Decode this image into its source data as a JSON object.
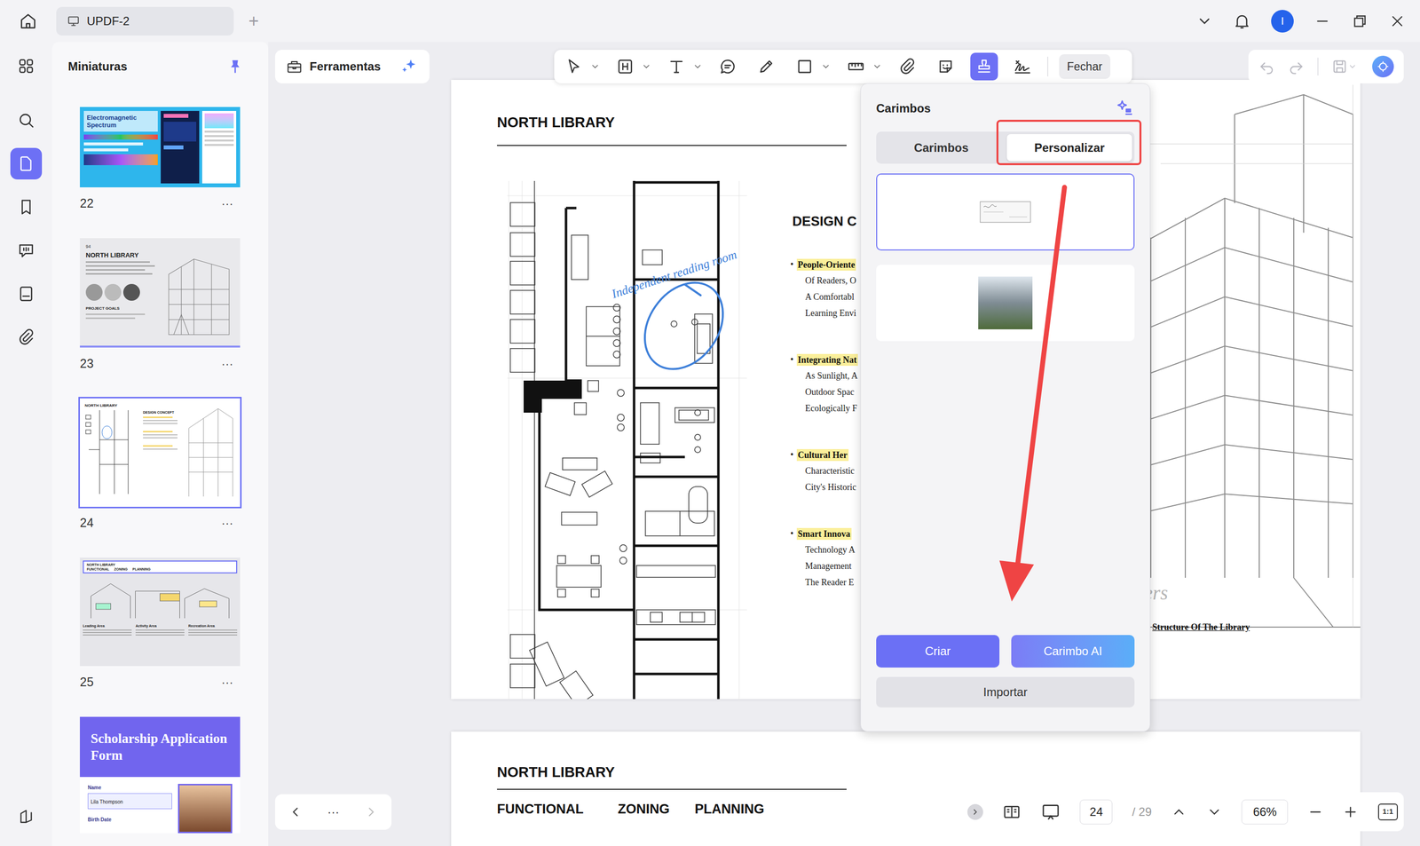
{
  "window": {
    "tab_title": "UPDF-2",
    "new_tab": "+",
    "avatar": "I"
  },
  "rail": [
    {
      "kind": "organize",
      "selected": false
    },
    {
      "kind": "search",
      "selected": false
    },
    {
      "kind": "pages",
      "selected": true
    },
    {
      "kind": "bookmark",
      "selected": false
    },
    {
      "kind": "comments",
      "selected": false
    },
    {
      "kind": "forms",
      "selected": false
    },
    {
      "kind": "attachments",
      "selected": false
    }
  ],
  "rail_bottom": {
    "kind": "theme",
    "selected": false
  },
  "thumbnails": {
    "title": "Miniaturas",
    "pages": [
      {
        "number": "22",
        "selected": false,
        "more": "···",
        "texts": [
          "Electromagnetic",
          "Spectrum"
        ]
      },
      {
        "number": "23",
        "selected": false,
        "more": "···",
        "texts": [
          "94",
          "NORTH LIBRARY",
          "PROJECT GOALS"
        ]
      },
      {
        "number": "24",
        "selected": true,
        "more": "···",
        "texts": [
          "NORTH LIBRARY",
          "DESIGN CONCEPT"
        ]
      },
      {
        "number": "25",
        "selected": false,
        "more": "···",
        "texts": [
          "NORTH LIBRARY",
          "FUNCTIONAL",
          "ZONING",
          "PLANNING",
          "Leading Area",
          "Activity Area",
          "Recreation Area"
        ]
      }
    ],
    "partial_page": {
      "title": "Scholarship Application Form",
      "field_label": "Name",
      "field_value": "Lila Thompson",
      "next_label": "Birth Date"
    }
  },
  "tools_panel": {
    "title": "Ferramentas",
    "nav_more": "···"
  },
  "toolbar": {
    "tools": [
      {
        "kind": "select",
        "menu": true,
        "selected": false
      },
      {
        "kind": "textbox",
        "menu": true,
        "selected": false
      },
      {
        "kind": "text",
        "menu": true,
        "selected": false
      },
      {
        "kind": "note",
        "menu": false,
        "selected": false
      },
      {
        "kind": "pencil",
        "menu": false,
        "selected": false
      },
      {
        "kind": "shape",
        "menu": true,
        "selected": false
      },
      {
        "kind": "measure",
        "menu": true,
        "selected": false
      },
      {
        "kind": "attach",
        "menu": false,
        "selected": false
      },
      {
        "kind": "sticker",
        "menu": false,
        "selected": false
      },
      {
        "kind": "stamp",
        "menu": false,
        "selected": true
      },
      {
        "kind": "signature",
        "menu": false,
        "selected": false
      }
    ],
    "close": "Fechar"
  },
  "actions": [
    {
      "kind": "undo",
      "disabled": true
    },
    {
      "kind": "redo",
      "disabled": true
    },
    {
      "kind": "save",
      "disabled": true
    }
  ],
  "stamp_panel": {
    "title": "Carimbos",
    "tabs": [
      {
        "label": "Carimbos",
        "selected": false,
        "highlighted": false
      },
      {
        "label": "Personalizar",
        "selected": true,
        "highlighted": true
      }
    ],
    "stamps": [
      {
        "selected": true
      },
      {
        "selected": false
      }
    ],
    "create": "Criar",
    "ai": "Carimbo AI",
    "import": "Importar"
  },
  "document": {
    "page1": {
      "title": "NORTH LIBRARY",
      "annotation": "Independent reading room",
      "heading": "DESIGN C",
      "bullet": "•",
      "bullets": [
        {
          "title": "People-Oriente",
          "lines": [
            "Of Readers, O",
            "A Comfortabl",
            "Learning Envi"
          ]
        },
        {
          "title": "Integrating Nat",
          "lines": [
            "As Sunlight, A",
            "Outdoor Spac",
            "Ecologically F"
          ]
        },
        {
          "title": "Cultural Her",
          "lines": [
            "Characteristic",
            "City's Historic"
          ]
        },
        {
          "title": "Smart Innova",
          "lines": [
            "Technology A",
            "Management",
            "The Reader E"
          ]
        }
      ],
      "fragment": "ers",
      "caption": "Structure Of The Library"
    },
    "page2": {
      "title": "NORTH LIBRARY",
      "headings": [
        "FUNCTIONAL",
        "ZONING",
        "PLANNING"
      ]
    }
  },
  "page_nav": {
    "current": "24",
    "total": "/ 29",
    "zoom": "66%",
    "actual_size": "1:1"
  }
}
